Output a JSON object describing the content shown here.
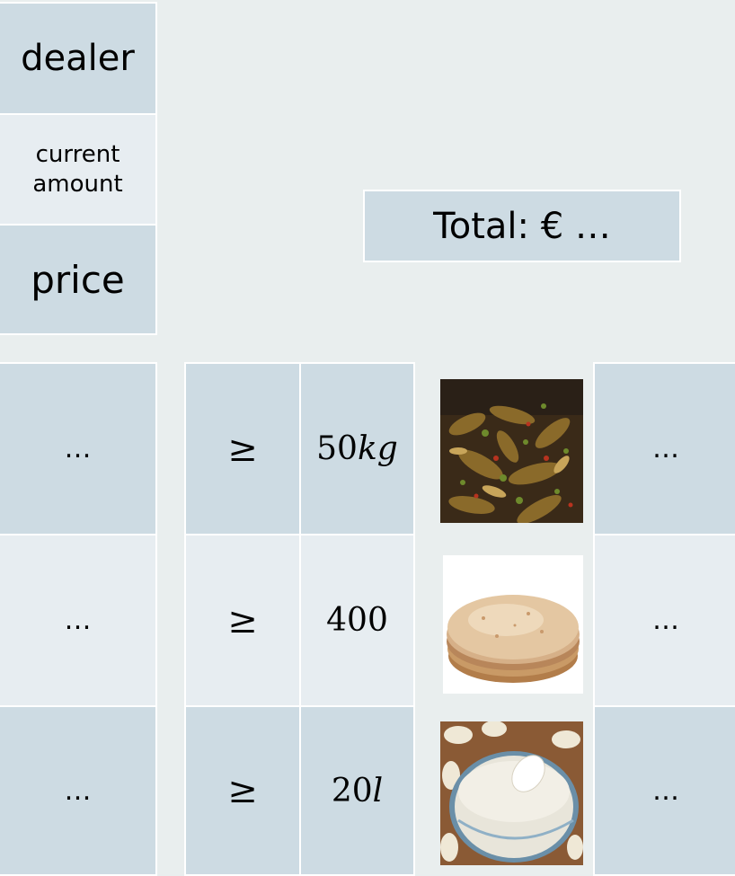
{
  "legend": {
    "dealer": "dealer",
    "current_amount": "current amount",
    "price": "price"
  },
  "total": "Total: € …",
  "rows": [
    {
      "dealer": "…",
      "relation": "≥",
      "amount_number": "50",
      "amount_unit": "kg",
      "price": "…",
      "food_icon": "curry-dish-image"
    },
    {
      "dealer": "…",
      "relation": "≥",
      "amount_number": "400",
      "amount_unit": "",
      "price": "…",
      "food_icon": "pita-bread-image"
    },
    {
      "dealer": "…",
      "relation": "≥",
      "amount_number": "20",
      "amount_unit": "l",
      "price": "…",
      "food_icon": "white-dip-image"
    }
  ],
  "colors": {
    "background": "#e9eeee",
    "cell_dark": "#cddbe3",
    "cell_light": "#e7edf1"
  }
}
